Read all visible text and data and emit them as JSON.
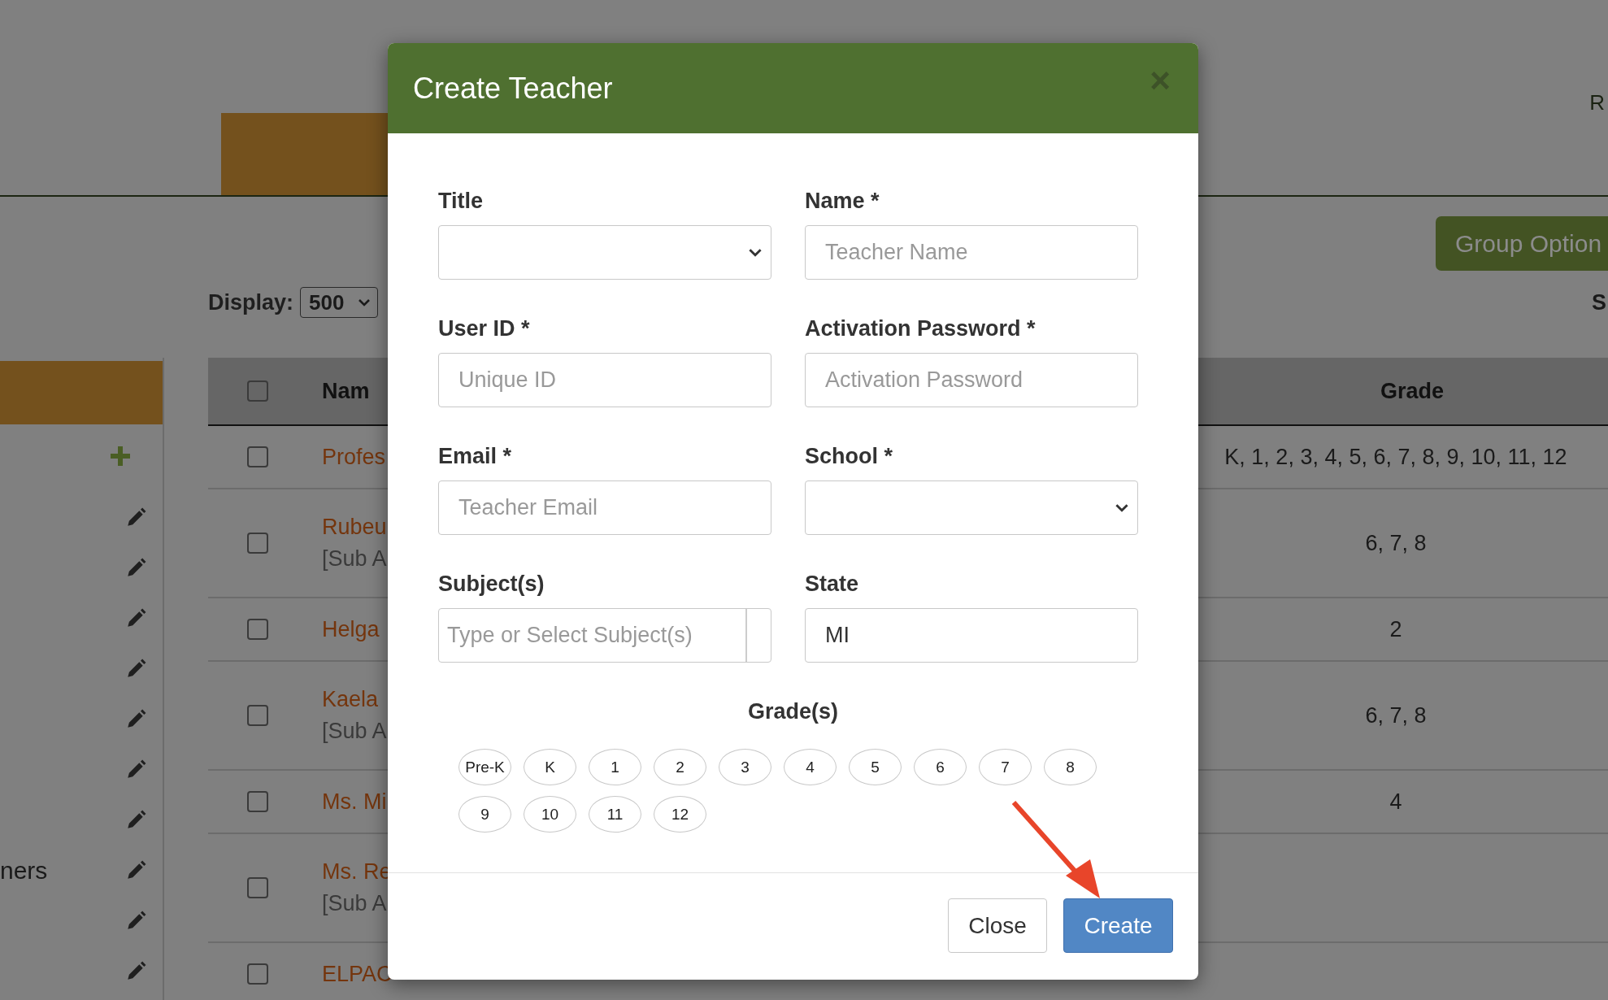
{
  "header": {
    "right_text": "R"
  },
  "toolbar": {
    "group_button": "Group Option",
    "display_label": "Display:",
    "display_value": "500",
    "right_text": "S"
  },
  "sidebar": {
    "items": [
      {
        "kind": "add"
      },
      {
        "kind": "edit"
      },
      {
        "kind": "edit"
      },
      {
        "kind": "edit"
      },
      {
        "kind": "edit"
      },
      {
        "kind": "edit"
      },
      {
        "kind": "edit"
      },
      {
        "kind": "edit"
      },
      {
        "kind": "edit",
        "label": "ners"
      },
      {
        "kind": "edit"
      },
      {
        "kind": "edit"
      }
    ]
  },
  "table": {
    "header": {
      "checked": false,
      "name": "Nam",
      "grade": "Grade"
    },
    "rows": [
      {
        "checked": false,
        "name": "Profes",
        "grade": "K, 1, 2, 3, 4, 5, 6, 7, 8, 9, 10, 11, 12"
      },
      {
        "checked": false,
        "name": "Rubeu",
        "sub": "[Sub A",
        "grade": "6, 7, 8"
      },
      {
        "checked": false,
        "name": "Helga",
        "grade": "2"
      },
      {
        "checked": false,
        "name": "Kaela",
        "sub": "[Sub A",
        "grade": "6, 7, 8"
      },
      {
        "checked": false,
        "name": "Ms. Mi",
        "grade": "4"
      },
      {
        "checked": false,
        "name": "Ms. Re",
        "sub": "[Sub A"
      },
      {
        "checked": false,
        "name": "ELPAC"
      }
    ]
  },
  "modal": {
    "title": "Create Teacher",
    "close_icon": "×",
    "fields": [
      {
        "label": "Title",
        "kind": "select"
      },
      {
        "label": "Name *",
        "kind": "input",
        "placeholder": "Teacher Name"
      },
      {
        "label": "User ID *",
        "kind": "input",
        "placeholder": "Unique ID"
      },
      {
        "label": "Activation Password *",
        "kind": "input",
        "placeholder": "Activation Password"
      },
      {
        "label": "Email *",
        "kind": "input",
        "placeholder": "Teacher Email"
      },
      {
        "label": "School *",
        "kind": "select"
      },
      {
        "label": "Subject(s)",
        "kind": "multiselect",
        "placeholder": "Type or Select Subject(s)"
      },
      {
        "label": "State",
        "kind": "input",
        "value": "MI"
      }
    ],
    "grades_label": "Grade(s)",
    "grades": [
      {
        "label": "Pre-K",
        "selected": false
      },
      {
        "label": "K",
        "selected": false
      },
      {
        "label": "1",
        "selected": false
      },
      {
        "label": "2",
        "selected": false
      },
      {
        "label": "3",
        "selected": false
      },
      {
        "label": "4",
        "selected": false
      },
      {
        "label": "5",
        "selected": false
      },
      {
        "label": "6",
        "selected": false
      },
      {
        "label": "7",
        "selected": false
      },
      {
        "label": "8",
        "selected": false
      },
      {
        "label": "9",
        "selected": false
      },
      {
        "label": "10",
        "selected": false
      },
      {
        "label": "11",
        "selected": false
      },
      {
        "label": "12",
        "selected": false
      }
    ],
    "buttons": [
      {
        "label": "Close",
        "kind": "secondary"
      },
      {
        "label": "Create",
        "kind": "primary"
      }
    ]
  }
}
